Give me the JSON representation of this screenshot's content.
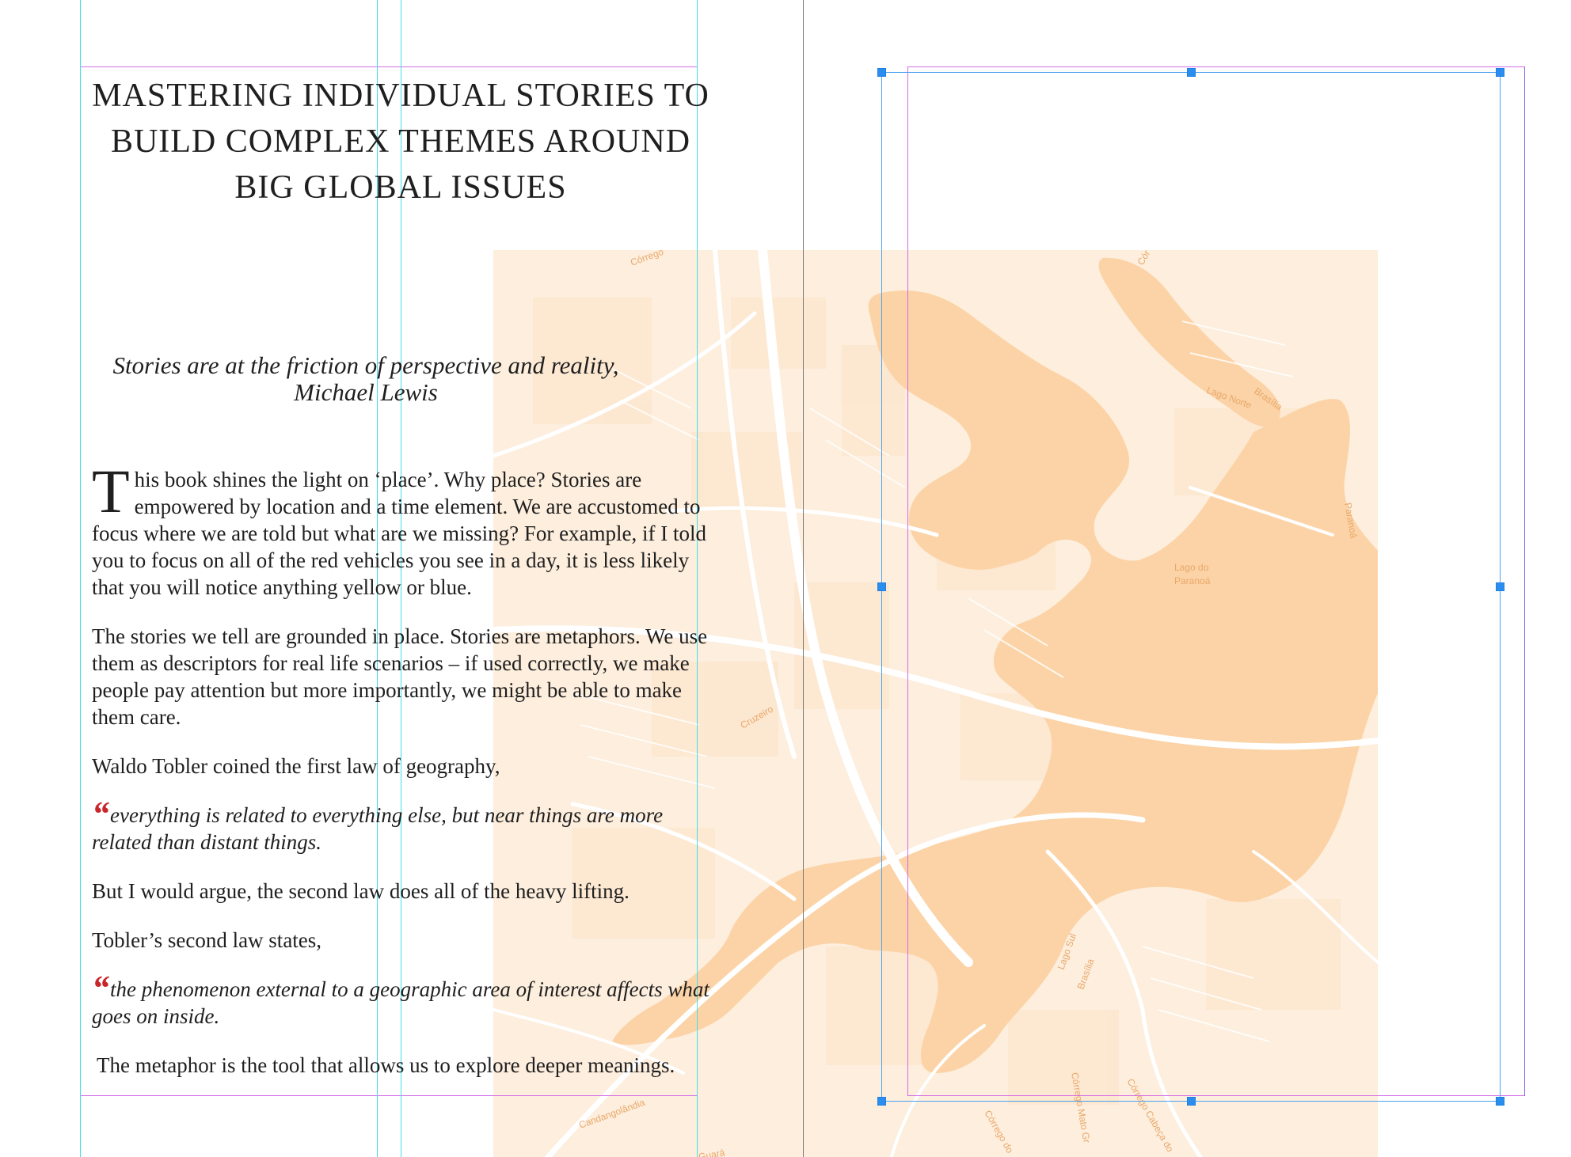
{
  "document": {
    "title": "MASTERING INDIVIDUAL STORIES TO BUILD COMPLEX THEMES AROUND BIG GLOBAL ISSUES",
    "epigraph": {
      "quote": "Stories are at the friction of perspective and reality,",
      "author": "Michael Lewis"
    },
    "paragraph1": {
      "drop_cap": "T",
      "text": "his book shines the light on ‘place’. Why place? Stories are empowered by location and a time element. We are accustomed to focus where we are told but what are we missing?  For example, if I told you to focus on all of the red vehicles you see in a day, it is less likely that you will notice anything yellow or blue."
    },
    "paragraph2": "The stories we tell are grounded in place. Stories are metaphors. We use them as descriptors for real life scenarios – if used correctly, we make people pay attention but more importantly, we might be able to make them care.",
    "paragraph3": "Waldo Tobler coined the first law of geography,",
    "quote1": {
      "mark": "“",
      "text": "everything is related to everything else, but near things are more related than distant things."
    },
    "paragraph4": "But I would argue, the second law does all of the heavy lifting.",
    "paragraph5": "Tobler’s second law states,",
    "quote2": {
      "mark": "“",
      "text": "the phenomenon external to a geographic area of interest affects what goes on inside."
    },
    "paragraph6": "The metaphor is the tool that allows us to explore deeper meanings."
  },
  "map": {
    "labels": {
      "lago_norte": "Lago Norte",
      "brasilia_n": "Brasília",
      "lago_paranoa_1": "Lago do",
      "lago_paranoa_2": "Paranoá",
      "paranoa": "Paranoá",
      "cruzeiro": "Cruzeiro",
      "lago_sul": "Lago Sul",
      "brasilia_s": "Brasília",
      "candango": "Candangolândia",
      "corrego_top": "Córrego",
      "corrego_top2": "Cór",
      "corrego_1": "Córrego do",
      "corrego_2": "Córrego Mato Gr",
      "corrego_3": "Córrego Cabeça do",
      "guara": "Guará"
    },
    "colors": {
      "land": "#fdeedd",
      "water": "#fcd3a6",
      "roads": "#ffffff",
      "label": "#e9a86a"
    }
  },
  "ui": {
    "guide_color": "#3fe0e8",
    "margin_color": "#d36be6",
    "selection_color": "#2a8ef0",
    "quote_mark_color": "#c8262b"
  }
}
